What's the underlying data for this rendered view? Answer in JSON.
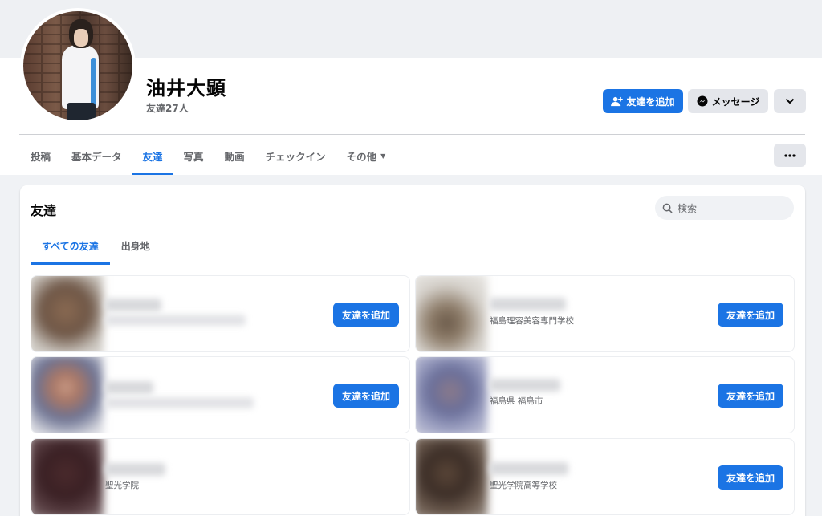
{
  "profile": {
    "name": "油井大顕",
    "friend_count": "友達27人"
  },
  "actions": {
    "add_friend": "友達を追加",
    "message": "メッセージ",
    "add_friend_icon": "person-plus-icon",
    "message_icon": "messenger-icon",
    "dropdown_icon": "chevron-down-icon",
    "more_icon": "more-dots-icon"
  },
  "nav": {
    "tabs": [
      "投稿",
      "基本データ",
      "友達",
      "写真",
      "動画",
      "チェックイン",
      "その他"
    ],
    "active": "友達"
  },
  "friends_section": {
    "title": "友達",
    "search_placeholder": "検索",
    "sub_tabs": [
      "すべての友達",
      "出身地"
    ],
    "active_sub_tab": "すべての友達"
  },
  "friends": [
    {
      "detail": "",
      "button": "友達を追加"
    },
    {
      "detail": "福島理容美容専門学校",
      "button": "友達を追加"
    },
    {
      "detail": "",
      "button": "友達を追加"
    },
    {
      "detail": "福島県 福島市",
      "button": "友達を追加"
    },
    {
      "detail": "聖光学院",
      "button": ""
    },
    {
      "detail": "聖光学院高等学校",
      "button": "友達を追加"
    }
  ],
  "colors": {
    "accent": "#1b74e4",
    "background": "#f0f2f5",
    "secondary_button": "#e4e6eb"
  }
}
